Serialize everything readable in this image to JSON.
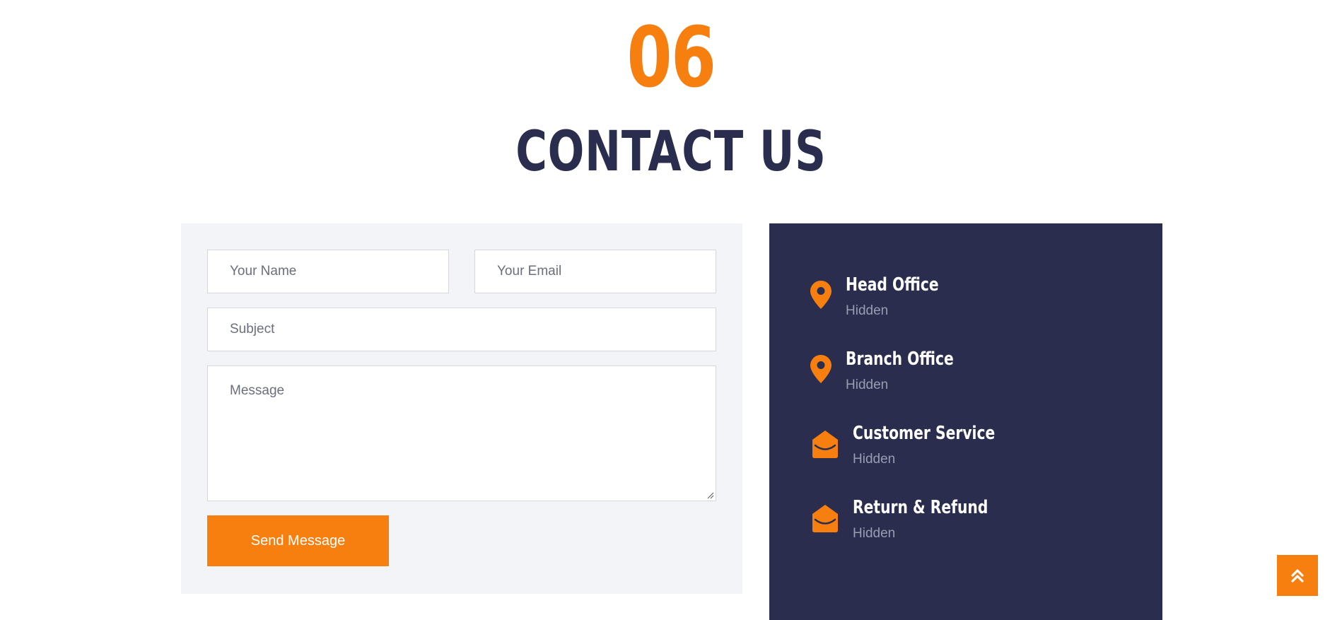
{
  "heading": {
    "number": "06",
    "title": "CONTACT US"
  },
  "form": {
    "name_placeholder": "Your Name",
    "email_placeholder": "Your Email",
    "subject_placeholder": "Subject",
    "message_placeholder": "Message",
    "submit_label": "Send Message"
  },
  "contact_info": {
    "items": [
      {
        "icon": "map-marker-icon",
        "title": "Head Office",
        "value": "Hidden"
      },
      {
        "icon": "map-marker-icon",
        "title": "Branch Office",
        "value": "Hidden"
      },
      {
        "icon": "envelope-open-icon",
        "title": "Customer Service",
        "value": "Hidden"
      },
      {
        "icon": "envelope-open-icon",
        "title": "Return & Refund",
        "value": "Hidden"
      }
    ]
  },
  "scroll_top": {
    "icon": "double-chevron-up-icon"
  },
  "colors": {
    "accent": "#f77f10",
    "navy": "#2a2d4e",
    "form_bg": "#f3f4f7",
    "muted_text": "#9a9cb2"
  }
}
